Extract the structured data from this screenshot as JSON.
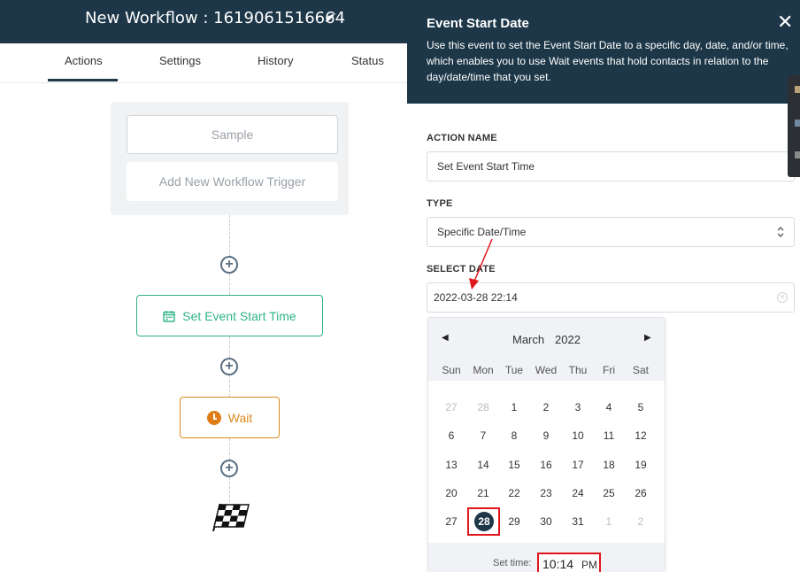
{
  "header": {
    "title": "New Workflow : 1619061516664"
  },
  "tabs": [
    {
      "label": "Actions",
      "active": true
    },
    {
      "label": "Settings"
    },
    {
      "label": "History"
    },
    {
      "label": "Status"
    }
  ],
  "canvas": {
    "triggers": [
      "Sample",
      "Add New Workflow Trigger"
    ],
    "nodes": [
      {
        "label": "Set Event Start Time",
        "icon": "calendar-icon",
        "color": "#2fb38a"
      },
      {
        "label": "Wait",
        "icon": "clock-icon",
        "color": "#d98a1f"
      }
    ]
  },
  "panel": {
    "title": "Event Start Date",
    "description": "Use this event to set the Event Start Date to a specific day, date, and/or time, which enables you to use Wait events that hold contacts in relation to the day/date/time that you set.",
    "action_name_label": "ACTION NAME",
    "action_name_value": "Set Event Start Time",
    "type_label": "TYPE",
    "type_value": "Specific Date/Time",
    "select_date_label": "SELECT DATE",
    "select_date_value": "2022-03-28 22:14"
  },
  "calendar": {
    "month": "March",
    "year": "2022",
    "weekdays": [
      "Sun",
      "Mon",
      "Tue",
      "Wed",
      "Thu",
      "Fri",
      "Sat"
    ],
    "weeks": [
      [
        "27",
        "28",
        "1",
        "2",
        "3",
        "4",
        "5"
      ],
      [
        "6",
        "7",
        "8",
        "9",
        "10",
        "11",
        "12"
      ],
      [
        "13",
        "14",
        "15",
        "16",
        "17",
        "18",
        "19"
      ],
      [
        "20",
        "21",
        "22",
        "23",
        "24",
        "25",
        "26"
      ],
      [
        "27",
        "28",
        "29",
        "30",
        "31",
        "1",
        "2"
      ]
    ],
    "selected_day": "28",
    "set_time_label": "Set time:",
    "time_value": "10:14",
    "ampm": "PM"
  },
  "colors": {
    "dark": "#1d3748",
    "highlight": "#e0161c"
  }
}
